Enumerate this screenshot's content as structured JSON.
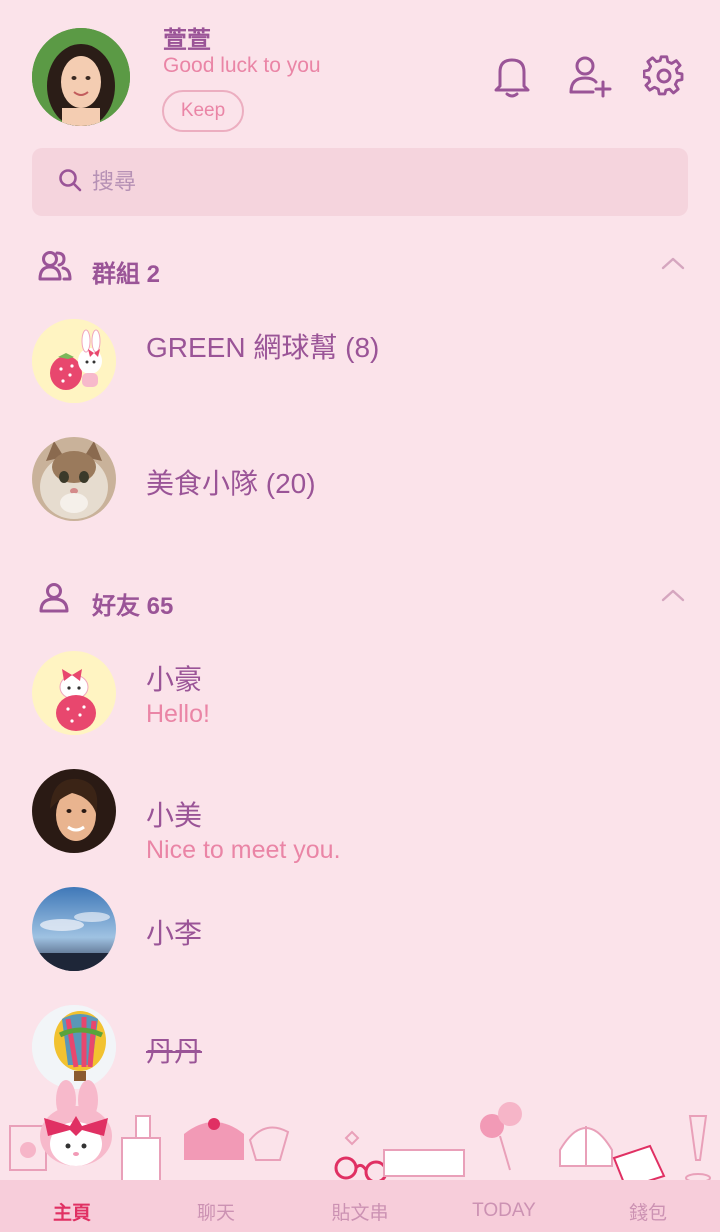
{
  "profile": {
    "name": "萱萱",
    "status": "Good luck to you",
    "keep_label": "Keep"
  },
  "header_icons": [
    "bell-icon",
    "add-friend-icon",
    "gear-icon"
  ],
  "search": {
    "placeholder": "搜尋"
  },
  "groups_section": {
    "label": "群組 2",
    "items": [
      {
        "title": "GREEN 網球幫 (8)"
      },
      {
        "title": "美食小隊 (20)"
      }
    ]
  },
  "friends_section": {
    "label": "好友 65",
    "items": [
      {
        "name": "小豪",
        "status": "Hello!"
      },
      {
        "name": "小美",
        "status": "Nice to meet you."
      },
      {
        "name": "小李"
      },
      {
        "name": "丹丹"
      }
    ]
  },
  "tabs": [
    {
      "label": "主頁",
      "active": true
    },
    {
      "label": "聊天"
    },
    {
      "label": "貼文串"
    },
    {
      "label": "TODAY"
    },
    {
      "label": "錢包"
    }
  ],
  "colors": {
    "background": "#fbe3ea",
    "accent": "#9a5497",
    "pink_text": "#ea85a6",
    "active_tab": "#e03063"
  }
}
